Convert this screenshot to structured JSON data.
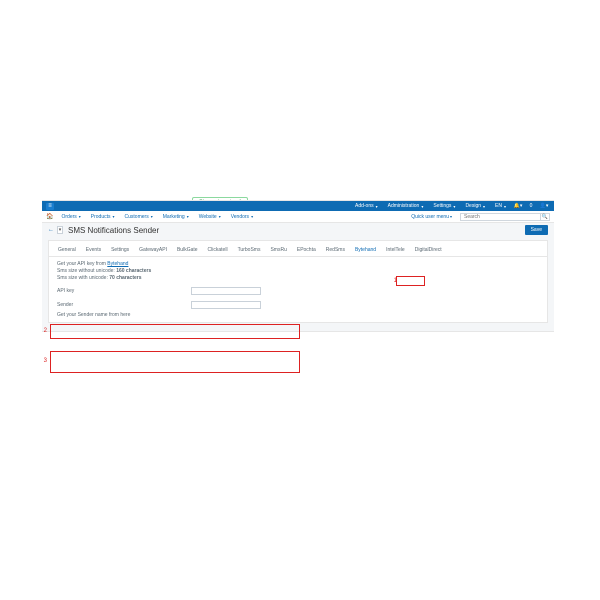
{
  "setup_banner": "Store setup wizard",
  "topmenu": {
    "addons": "Add-ons",
    "administration": "Administration",
    "settings": "Settings",
    "design": "Design",
    "lang": "EN"
  },
  "topicons": {
    "alerts": "0"
  },
  "subnav": {
    "orders": "Orders",
    "products": "Products",
    "customers": "Customers",
    "marketing": "Marketing",
    "website": "Website",
    "vendors": "Vendors"
  },
  "quick": "Quick user menu",
  "search_placeholder": "Search",
  "title": "SMS Notifications Sender",
  "save": "Save",
  "tabs": [
    "General",
    "Events",
    "Settings",
    "GatewayAPI",
    "BulkGate",
    "Clickatell",
    "TurboSms",
    "SmsRu",
    "EPochta",
    "RedSms",
    "Bytehand",
    "IntelTele",
    "DigitalDirect"
  ],
  "active_tab_index": 10,
  "info": {
    "l1a": "Get your API key from ",
    "l1b": "Bytehand",
    "l2a": "Sms size without unicode: ",
    "l2b": "160 characters",
    "l3a": "Sms size with unicode: ",
    "l3b": "70 characters"
  },
  "fields": {
    "api_key": "API key",
    "sender": "Sender"
  },
  "hint": {
    "a": "Get your Sender name from ",
    "b": "here"
  },
  "annotations": {
    "tab": "1",
    "f1": "2",
    "f2": "3"
  }
}
